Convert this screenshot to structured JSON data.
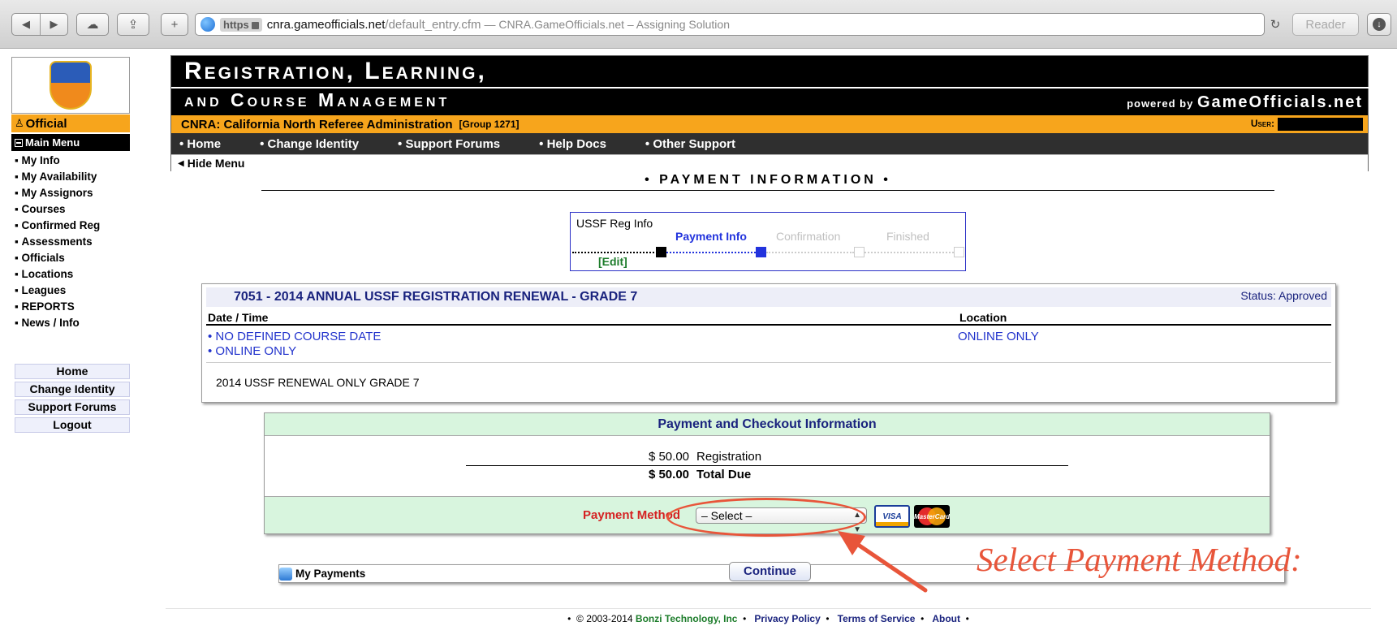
{
  "browser": {
    "https_label": "https",
    "url_host": "cnra.gameofficials.net",
    "url_path": "/default_entry.cfm",
    "page_title": "— CNRA.GameOfficials.net – Assigning Solution",
    "reader_label": "Reader"
  },
  "sidebar": {
    "official_label": "Official",
    "main_menu_label": "Main Menu",
    "items": [
      "My Info",
      "My Availability",
      "My Assignors",
      "My Payments",
      "Courses",
      "Confirmed Reg",
      "Assessments",
      "Officials",
      "Locations",
      "Leagues",
      "REPORTS",
      "News / Info"
    ],
    "buttons": [
      "Home",
      "Change Identity",
      "Support Forums",
      "Logout"
    ]
  },
  "banner": {
    "line1": "Registration, Learning,",
    "line2": "and Course Management",
    "powered_by": "powered by",
    "powered_brand": "GameOfficials.net",
    "org": "CNRA: California North Referee Administration",
    "group": "[Group 1271]",
    "user_label": "User:",
    "nav": [
      "Home",
      "Change Identity",
      "Support Forums",
      "Help Docs",
      "Other Support"
    ],
    "hide_menu": "Hide Menu"
  },
  "page_title": "• PAYMENT INFORMATION •",
  "steps": {
    "s1": "USSF Reg Info",
    "edit": "[Edit]",
    "s2": "Payment Info",
    "s3": "Confirmation",
    "s4": "Finished",
    "current_step": 2,
    "colors": {
      "done": "#000000",
      "current": "#2233dd",
      "pending": "#cccccc"
    }
  },
  "course": {
    "title": "7051 - 2014 ANNUAL USSF REGISTRATION RENEWAL - GRADE 7",
    "status": "Status: Approved",
    "col_date": "Date / Time",
    "col_location": "Location",
    "date_1": "• NO DEFINED COURSE DATE",
    "date_2": "• ONLINE ONLY",
    "location": "ONLINE ONLY",
    "description": "2014 USSF RENEWAL ONLY GRADE 7"
  },
  "payment": {
    "header": "Payment and Checkout Information",
    "reg_amount": "$ 50.00",
    "reg_label": "Registration",
    "total_amount": "$ 50.00",
    "total_label": "Total Due",
    "method_label": "Payment Method",
    "select_value": "– Select –",
    "visa": "VISA",
    "mastercard": "MasterCard"
  },
  "annotation": "Select Payment Method:",
  "continue_label": "Continue",
  "footer": {
    "copyright": "© 2003-2014",
    "company": "Bonzi Technology, Inc",
    "privacy": "Privacy Policy",
    "terms": "Terms of Service",
    "about": "About"
  },
  "accent_colors": {
    "orange": "#f7a51c",
    "annotation": "#e8553a",
    "navy": "#1a237e",
    "green_bg": "#d8f5de"
  }
}
